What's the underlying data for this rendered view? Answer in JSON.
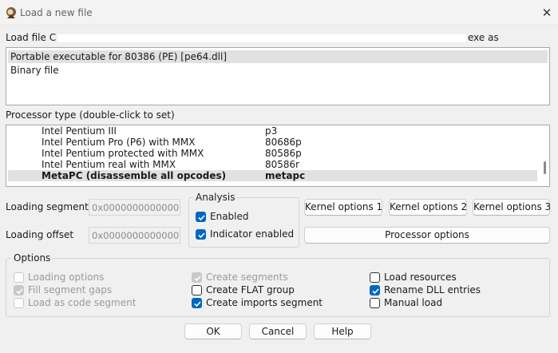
{
  "window": {
    "title": "Load a new file"
  },
  "load_file": {
    "label": "Load file C",
    "suffix": "exe as",
    "options": [
      {
        "label": "Portable executable for 80386 (PE) [pe64.dll]",
        "selected": true
      },
      {
        "label": "Binary file",
        "selected": false
      }
    ]
  },
  "processor": {
    "label": "Processor type (double-click to set)",
    "items": [
      {
        "name": "Intel Pentium III",
        "code": "p3",
        "selected": false
      },
      {
        "name": "Intel Pentium Pro (P6) with MMX",
        "code": "80686p",
        "selected": false
      },
      {
        "name": "Intel Pentium protected with MMX",
        "code": "80586p",
        "selected": false
      },
      {
        "name": "Intel Pentium real with MMX",
        "code": "80586r",
        "selected": false
      },
      {
        "name": "MetaPC (disassemble all opcodes)",
        "code": "metapc",
        "selected": true
      }
    ]
  },
  "segments": {
    "loading_segment_label": "Loading segment",
    "loading_segment_value": "0x0000000000000000",
    "loading_offset_label": "Loading offset",
    "loading_offset_value": "0x0000000000000000"
  },
  "analysis": {
    "title": "Analysis",
    "enabled_label": "Enabled",
    "enabled_checked": true,
    "indicator_label": "Indicator enabled",
    "indicator_checked": true
  },
  "kernel_buttons": {
    "k1": "Kernel options 1",
    "k2": "Kernel options 2",
    "k3": "Kernel options 3",
    "processor_options": "Processor options"
  },
  "options": {
    "title": "Options",
    "loading_options": {
      "label": "Loading options",
      "checked": false,
      "disabled": true
    },
    "fill_segment_gaps": {
      "label": "Fill segment gaps",
      "checked": true,
      "disabled": true
    },
    "load_as_code_segment": {
      "label": "Load as code segment",
      "checked": false,
      "disabled": true
    },
    "create_segments": {
      "label": "Create segments",
      "checked": true,
      "disabled": true
    },
    "create_flat_group": {
      "label": "Create FLAT group",
      "checked": false,
      "disabled": false
    },
    "create_imports_segment": {
      "label": "Create imports segment",
      "checked": true,
      "disabled": false
    },
    "load_resources": {
      "label": "Load resources",
      "checked": false,
      "disabled": false
    },
    "rename_dll_entries": {
      "label": "Rename DLL entries",
      "checked": true,
      "disabled": false
    },
    "manual_load": {
      "label": "Manual load",
      "checked": false,
      "disabled": false
    }
  },
  "footer": {
    "ok": "OK",
    "cancel": "Cancel",
    "help": "Help"
  },
  "colors": {
    "accent": "#0067c0",
    "selection": "#e1e1e1",
    "disabled": "#9a9a9a"
  }
}
